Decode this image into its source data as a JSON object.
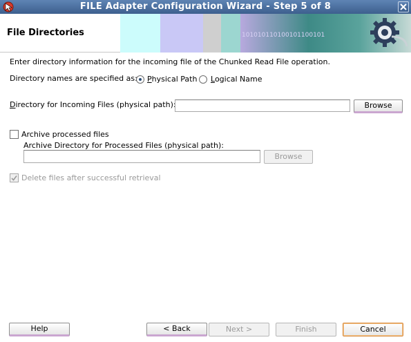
{
  "window": {
    "title": "FILE Adapter Configuration Wizard - Step 5 of 8",
    "close_label": "×"
  },
  "header": {
    "title": "File Directories"
  },
  "content": {
    "intro": "Enter directory information for the incoming file of the Chunked Read File operation.",
    "dir_names_label": "Directory names are specified as:",
    "radio_physical": {
      "label": "Physical Path",
      "selected": true
    },
    "radio_logical": {
      "label": "Logical Name",
      "selected": false
    },
    "incoming_label": "Directory for Incoming Files (physical path):",
    "incoming_value": "",
    "browse_label": "Browse",
    "archive_check": {
      "label": "Archive processed files",
      "checked": false
    },
    "archive_dir_label": "Archive Directory for Processed Files (physical path):",
    "archive_value": "",
    "archive_browse_label": "Browse",
    "delete_check": {
      "label": "Delete files after successful retrieval",
      "checked": true,
      "enabled": false
    }
  },
  "footer": {
    "help": "Help",
    "back": "< Back",
    "next": "Next >",
    "finish": "Finish",
    "cancel": "Cancel"
  },
  "colors": {
    "titlebar": "#4a6fa0",
    "accent_underline": "#caa6d0",
    "primary_border": "#d98a3a"
  }
}
